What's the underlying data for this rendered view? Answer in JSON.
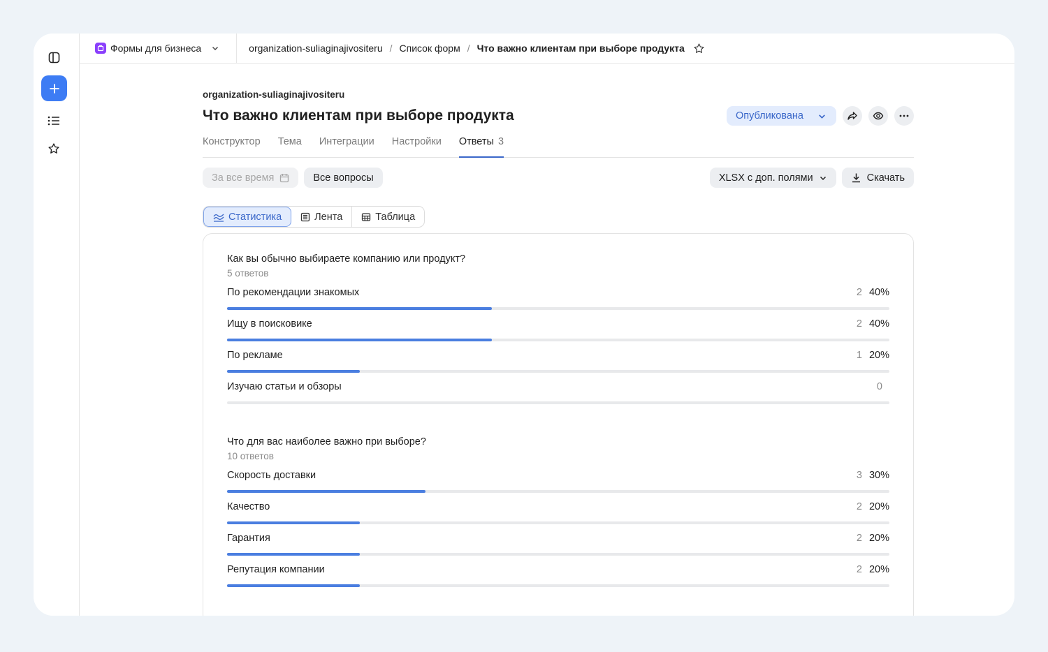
{
  "topbar": {
    "product_label": "Формы для бизнеса",
    "breadcrumbs": [
      "organization-suliaginajivositeru",
      "Список форм",
      "Что важно клиентам при выборе продукта"
    ]
  },
  "header": {
    "org": "organization-suliaginajivositeru",
    "title": "Что важно клиентам при выборе продукта",
    "status": "Опубликована"
  },
  "tabs": [
    {
      "label": "Конструктор"
    },
    {
      "label": "Тема"
    },
    {
      "label": "Интеграции"
    },
    {
      "label": "Настройки"
    },
    {
      "label": "Ответы",
      "count": "3",
      "active": true
    }
  ],
  "filters": {
    "period": "За все время",
    "questions": "Все вопросы",
    "format": "XLSX с доп. полями",
    "download": "Скачать"
  },
  "views": [
    {
      "label": "Статистика",
      "icon": "chart-lines-icon",
      "active": true
    },
    {
      "label": "Лента",
      "icon": "feed-icon"
    },
    {
      "label": "Таблица",
      "icon": "table-icon"
    }
  ],
  "questions": [
    {
      "title": "Как вы обычно выбираете компанию или продукт?",
      "count": "5 ответов",
      "options": [
        {
          "label": "По рекомендации знакомых",
          "n": "2",
          "pct": "40%",
          "fraction": 0.4
        },
        {
          "label": "Ищу в поисковике",
          "n": "2",
          "pct": "40%",
          "fraction": 0.4
        },
        {
          "label": "По рекламе",
          "n": "1",
          "pct": "20%",
          "fraction": 0.2
        },
        {
          "label": "Изучаю статьи и обзоры",
          "n": "0",
          "pct": "",
          "fraction": 0
        }
      ]
    },
    {
      "title": "Что для вас наиболее важно при выборе?",
      "count": "10 ответов",
      "options": [
        {
          "label": "Скорость доставки",
          "n": "3",
          "pct": "30%",
          "fraction": 0.3
        },
        {
          "label": "Качество",
          "n": "2",
          "pct": "20%",
          "fraction": 0.2
        },
        {
          "label": "Гарантия",
          "n": "2",
          "pct": "20%",
          "fraction": 0.2
        },
        {
          "label": "Репутация компании",
          "n": "2",
          "pct": "20%",
          "fraction": 0.2
        }
      ]
    }
  ],
  "colors": {
    "accent": "#4a7ee0",
    "primary_button": "#3d7cf4",
    "status_bg": "#e3ecfd"
  }
}
